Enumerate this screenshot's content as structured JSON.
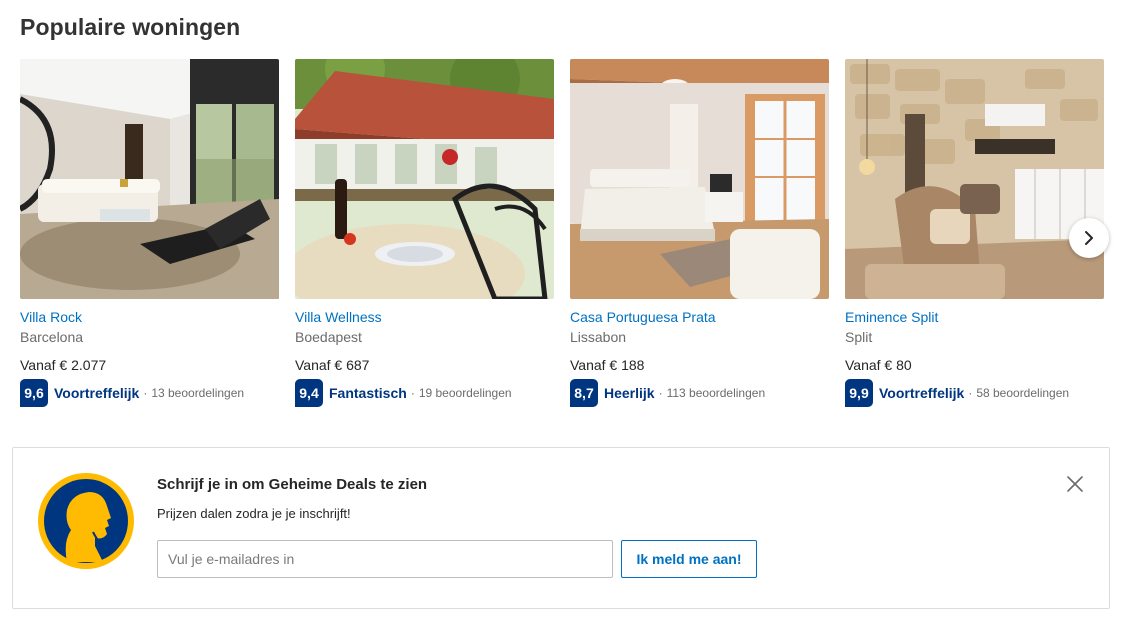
{
  "section": {
    "title": "Populaire woningen"
  },
  "cards": [
    {
      "name": "Villa Rock",
      "city": "Barcelona",
      "price": "Vanaf € 2.077",
      "score": "9,6",
      "rating_word": "Voortreffelijk",
      "separator": "·",
      "reviews": "13 beoordelingen"
    },
    {
      "name": "Villa Wellness",
      "city": "Boedapest",
      "price": "Vanaf € 687",
      "score": "9,4",
      "rating_word": "Fantastisch",
      "separator": "·",
      "reviews": "19 beoordelingen"
    },
    {
      "name": "Casa Portuguesa Prata",
      "city": "Lissabon",
      "price": "Vanaf € 188",
      "score": "8,7",
      "rating_word": "Heerlijk",
      "separator": "·",
      "reviews": "113 beoordelingen"
    },
    {
      "name": "Eminence Split",
      "city": "Split",
      "price": "Vanaf € 80",
      "score": "9,9",
      "rating_word": "Voortreffelijk",
      "separator": "·",
      "reviews": "58 beoordelingen"
    }
  ],
  "carousel": {
    "next_icon": "chevron-right-icon"
  },
  "banner": {
    "logo_icon": "secret-deals-logo",
    "title": "Schrijf je in om Geheime Deals te zien",
    "subtitle": "Prijzen dalen zodra je je inschrijft!",
    "email_placeholder": "Vul je e-mailadres in",
    "email_value": "",
    "button_label": "Ik meld me aan!",
    "close_icon": "close-icon"
  },
  "colors": {
    "link": "#0071c2",
    "badge": "#003580",
    "logo_yellow": "#febb02",
    "logo_blue": "#003580"
  }
}
